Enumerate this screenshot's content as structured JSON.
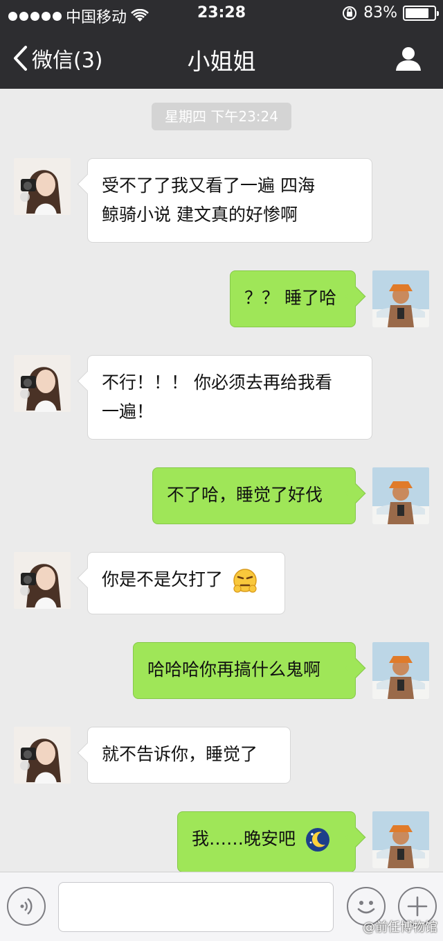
{
  "status_bar": {
    "carrier": "中国移动",
    "time": "23:28",
    "battery": "83%",
    "battery_level": 0.83
  },
  "nav": {
    "back_label": "微信(3)",
    "title": "小姐姐",
    "user_icon": "person-icon"
  },
  "chat": {
    "timestamp": "星期四 下午23:24",
    "messages": [
      {
        "from": "contact",
        "line1": "受不了了我又看了一遍 四海",
        "line2": "鲸骑小说 建文真的好惨啊"
      },
      {
        "from": "me",
        "text": "？？ 睡了哈"
      },
      {
        "from": "contact",
        "line1": "不行！！！ 你必须去再给我看",
        "line2": "一遍！"
      },
      {
        "from": "me",
        "text": "不了哈，睡觉了好伐"
      },
      {
        "from": "contact",
        "text": "你是不是欠打了",
        "emoji": "smirk-emoji"
      },
      {
        "from": "me",
        "text": "哈哈哈你再搞什么鬼啊"
      },
      {
        "from": "contact",
        "text": "就不告诉你，睡觉了"
      },
      {
        "from": "me",
        "text": "我……晚安吧",
        "emoji": "moon-sleep-emoji"
      }
    ]
  },
  "input_bar": {
    "value": "",
    "voice_icon": "voice-icon",
    "face_icon": "smiley-icon",
    "plus_icon": "plus-icon"
  },
  "watermark": "@前任博物馆",
  "colors": {
    "header_bg": "#2d2d30",
    "chat_bg": "#ebebeb",
    "outgoing_bubble": "#9fe658",
    "incoming_bubble": "#ffffff"
  }
}
